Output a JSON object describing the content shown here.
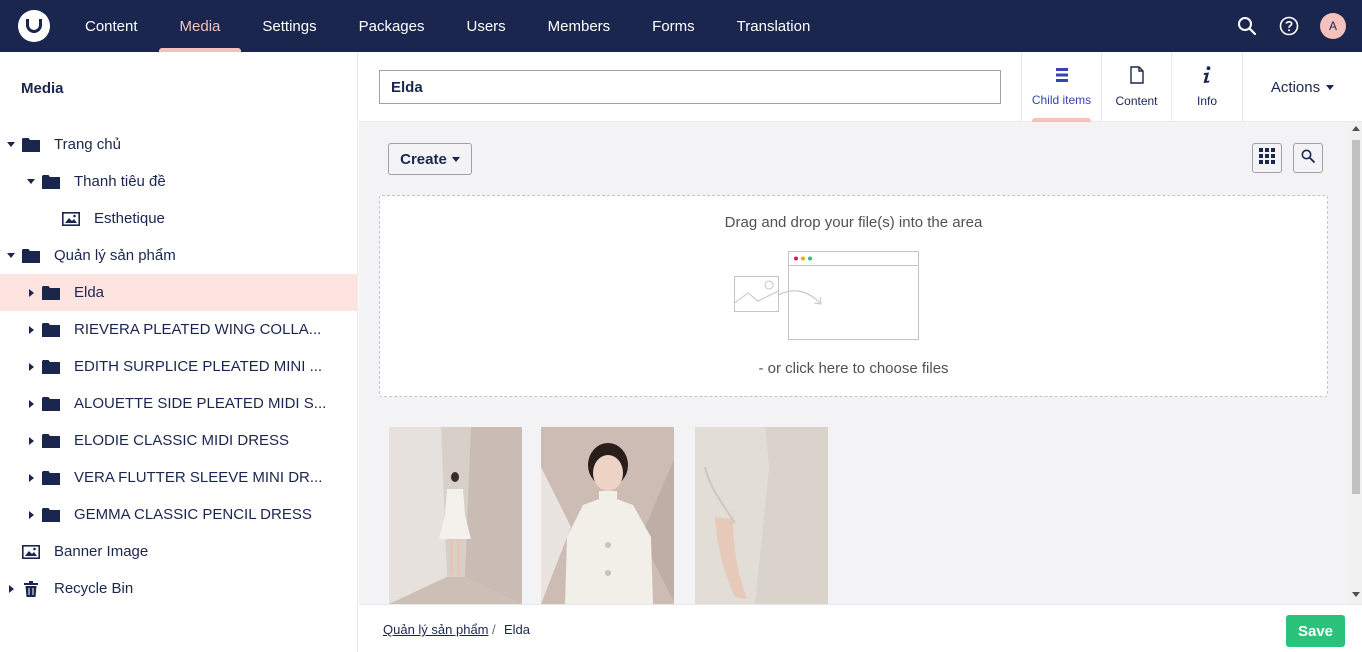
{
  "topbar": {
    "nav": [
      "Content",
      "Media",
      "Settings",
      "Packages",
      "Users",
      "Members",
      "Forms",
      "Translation"
    ],
    "active_nav": "Media",
    "avatar_initial": "A"
  },
  "sidebar": {
    "title": "Media",
    "items": [
      {
        "label": "Trang chủ",
        "icon": "folder-icon",
        "caret": "down"
      },
      {
        "label": "Thanh tiêu đề",
        "icon": "folder-icon",
        "caret": "down"
      },
      {
        "label": "Esthetique",
        "icon": "image-icon",
        "caret": ""
      },
      {
        "label": "Quản lý sản phẩm",
        "icon": "folder-icon",
        "caret": "down"
      },
      {
        "label": "Elda",
        "icon": "folder-icon",
        "caret": "right"
      },
      {
        "label": "RIEVERA PLEATED WING COLLA...",
        "icon": "folder-icon",
        "caret": "right"
      },
      {
        "label": "EDITH SURPLICE PLEATED MINI ...",
        "icon": "folder-icon",
        "caret": "right"
      },
      {
        "label": "ALOUETTE SIDE PLEATED MIDI S...",
        "icon": "folder-icon",
        "caret": "right"
      },
      {
        "label": "ELODIE CLASSIC MIDI DRESS",
        "icon": "folder-icon",
        "caret": "right"
      },
      {
        "label": "VERA FLUTTER SLEEVE MINI DR...",
        "icon": "folder-icon",
        "caret": "right"
      },
      {
        "label": "GEMMA CLASSIC PENCIL DRESS",
        "icon": "folder-icon",
        "caret": "right"
      },
      {
        "label": "Banner Image",
        "icon": "image-icon",
        "caret": ""
      },
      {
        "label": "Recycle Bin",
        "icon": "trash-icon",
        "caret": "right"
      }
    ]
  },
  "header": {
    "name_value": "Elda",
    "tabs": [
      {
        "label": "Child items",
        "icon": "list-icon"
      },
      {
        "label": "Content",
        "icon": "document-icon"
      },
      {
        "label": "Info",
        "icon": "info-icon"
      }
    ],
    "actions_label": "Actions"
  },
  "toolbar": {
    "create_label": "Create"
  },
  "dropzone": {
    "drag_text": "Drag and drop your file(s) into the area",
    "click_text": "- or click here to choose files"
  },
  "media_items": [
    {
      "name": "Elda full-length white dress photo"
    },
    {
      "name": "Elda portrait white dress photo"
    },
    {
      "name": "Elda sleeve tweed detail photo"
    }
  ],
  "footer": {
    "breadcrumb_parent": "Quản lý sản phẩm",
    "breadcrumb_separator": "/",
    "breadcrumb_current": "Elda",
    "save_label": "Save"
  },
  "colors": {
    "topbar": "#1b264f",
    "accent": "#f5c1bc",
    "selected_row": "#fee4e1",
    "save": "#2bc37c"
  }
}
